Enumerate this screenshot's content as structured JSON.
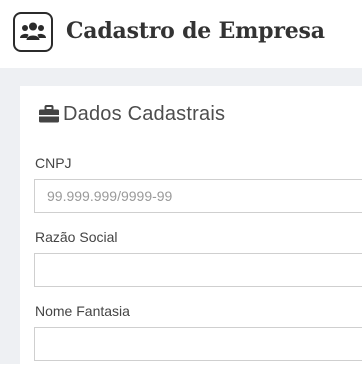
{
  "header": {
    "title": "Cadastro de Empresa",
    "icon": "users-icon"
  },
  "section": {
    "title": "Dados Cadastrais",
    "icon": "briefcase-icon"
  },
  "form": {
    "cnpj": {
      "label": "CNPJ",
      "placeholder": "99.999.999/9999-99",
      "value": ""
    },
    "razao_social": {
      "label": "Razão Social",
      "placeholder": "",
      "value": ""
    },
    "nome_fantasia": {
      "label": "Nome Fantasia",
      "placeholder": "",
      "value": ""
    }
  },
  "colors": {
    "background": "#eef0f3",
    "panel": "#ffffff",
    "icon_dark": "#2b2b2b"
  }
}
